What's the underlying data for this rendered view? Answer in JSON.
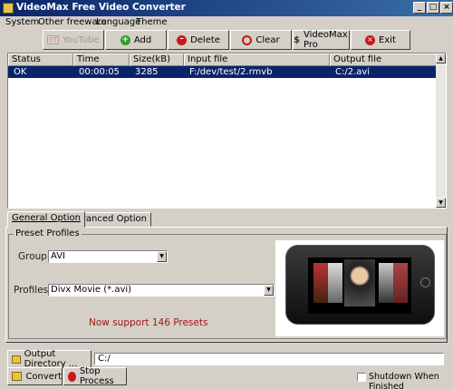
{
  "window": {
    "title": "VideoMax Free Video Converter"
  },
  "menu": [
    "System",
    "Other freeware",
    "Language",
    "Theme"
  ],
  "toolbar": {
    "youtube": "YouTube",
    "add": "Add",
    "delete": "Delete",
    "clear": "Clear",
    "pro": "VideoMax Pro",
    "exit": "Exit"
  },
  "file_list": {
    "columns": [
      "Status",
      "Time",
      "Size(kB)",
      "Input file",
      "Output file"
    ],
    "rows": [
      {
        "status": "OK",
        "time": "00:00:05",
        "size": "3285",
        "input": "F:/dev/test/2.rmvb",
        "output": "C:/2.avi"
      }
    ]
  },
  "tabs": [
    "General Option",
    "Advanced Option"
  ],
  "preset_profiles": {
    "label": "Preset Profiles",
    "group_label": "Group:",
    "group_value": "AVI",
    "profiles_label": "Profiles:",
    "profiles_value": "Divx Movie (*.avi)",
    "note": "Now support 146 Presets"
  },
  "output": {
    "dir_button": "Output Directory ...",
    "dir_value": "C:/"
  },
  "actions": {
    "convert": "Convert",
    "stop": "Stop Process",
    "shutdown": "Shutdown When Finished"
  },
  "colors": {
    "selection": "#0a246a",
    "accent_red": "#c81818",
    "note_red": "#a01818"
  },
  "icons": [
    "app-icon",
    "youtube-icon",
    "add-icon",
    "delete-icon",
    "clear-icon",
    "pro-icon",
    "exit-icon",
    "folder-icon",
    "convert-icon",
    "stop-icon"
  ]
}
